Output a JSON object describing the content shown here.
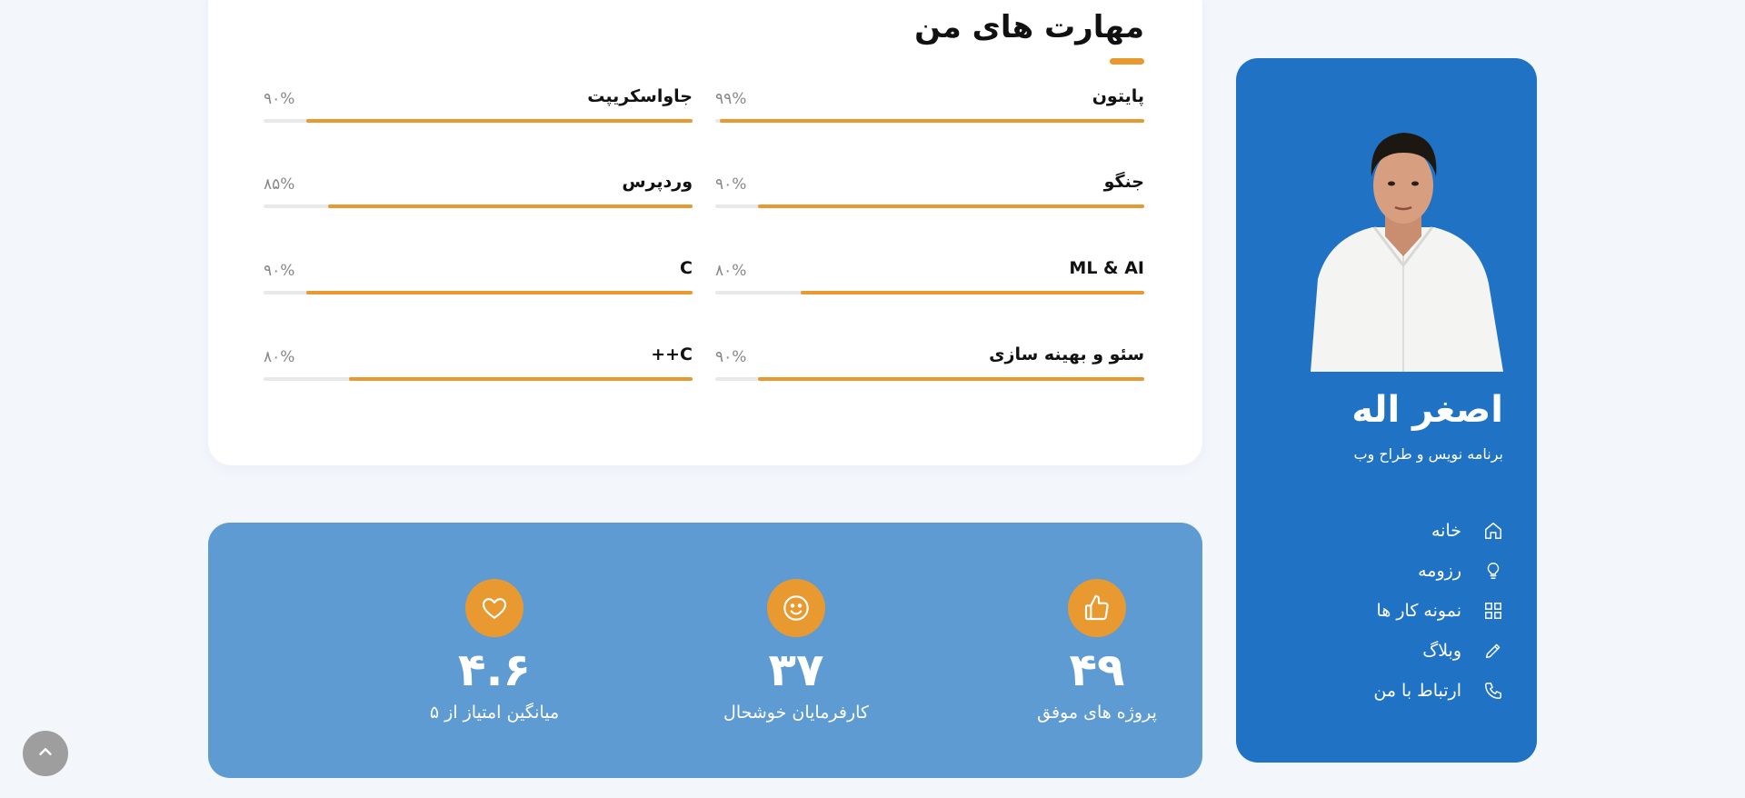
{
  "skills": {
    "title": "مهارت های من",
    "accent_color": "#e89a30",
    "items": [
      {
        "name": "پایتون",
        "percent_label": "۹۹%",
        "percent": 99
      },
      {
        "name": "جاواسکریپت",
        "percent_label": "۹۰%",
        "percent": 90
      },
      {
        "name": "جنگو",
        "percent_label": "۹۰%",
        "percent": 90
      },
      {
        "name": "وردپرس",
        "percent_label": "۸۵%",
        "percent": 85
      },
      {
        "name": "ML & AI",
        "percent_label": "۸۰%",
        "percent": 80
      },
      {
        "name": "C",
        "percent_label": "۹۰%",
        "percent": 90
      },
      {
        "name": "سئو و بهینه سازی",
        "percent_label": "۹۰%",
        "percent": 90
      },
      {
        "name": "C++",
        "percent_label": "۸۰%",
        "percent": 80
      }
    ]
  },
  "stats": {
    "background": "#5e9bd3",
    "items": [
      {
        "icon": "thumbs-up-icon",
        "value": "۴۹",
        "label": "پروژه های موفق"
      },
      {
        "icon": "smile-icon",
        "value": "۳۷",
        "label": "کارفرمایان خوشحال"
      },
      {
        "icon": "heart-icon",
        "value": "۴.۶",
        "label": "میانگین امتیاز از ۵"
      }
    ]
  },
  "profile": {
    "background": "#1f72c4",
    "name": "اصغر اله",
    "role": "برنامه نویس و طراح وب",
    "nav": [
      {
        "icon": "home-icon",
        "label": "خانه"
      },
      {
        "icon": "lightbulb-icon",
        "label": "رزومه"
      },
      {
        "icon": "grid-icon",
        "label": "نمونه کار ها"
      },
      {
        "icon": "pencil-icon",
        "label": "وبلاگ"
      },
      {
        "icon": "phone-icon",
        "label": "ارتباط با من"
      }
    ]
  },
  "scroll_top": {
    "icon": "chevron-up-icon"
  }
}
